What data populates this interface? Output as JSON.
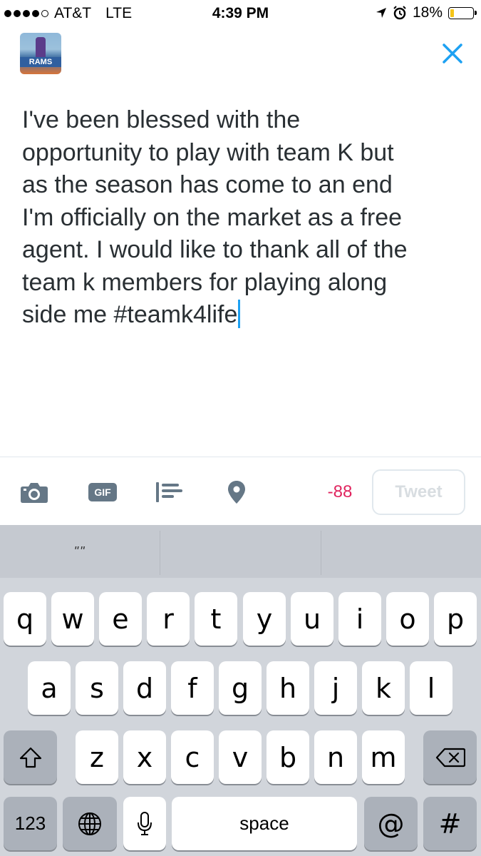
{
  "status_bar": {
    "carrier": "AT&T",
    "network": "LTE",
    "time": "4:39 PM",
    "battery_text": "18%",
    "battery_level": 0.18,
    "battery_color": "#f5c518"
  },
  "header": {
    "avatar_icon": "profile-photo-icon",
    "close_icon": "close-x-icon",
    "accent_color": "#1da1f2"
  },
  "compose": {
    "text": "I've been blessed with the\nopportunity to play with team K but\nas the season has come to an end\nI'm officially on the market as a free\nagent. I would like to thank all of the\nteam k members for playing along\nside me #teamk4life"
  },
  "toolbar": {
    "camera_icon": "camera-icon",
    "gif_label": "GIF",
    "poll_icon": "poll-icon",
    "location_icon": "location-pin-icon",
    "char_count": "-88",
    "tweet_label": "Tweet"
  },
  "keyboard": {
    "prediction": "\"\"",
    "row1": [
      "q",
      "w",
      "e",
      "r",
      "t",
      "y",
      "u",
      "i",
      "o",
      "p"
    ],
    "row2": [
      "a",
      "s",
      "d",
      "f",
      "g",
      "h",
      "j",
      "k",
      "l"
    ],
    "row3": [
      "z",
      "x",
      "c",
      "v",
      "b",
      "n",
      "m"
    ],
    "numbers_label": "123",
    "space_label": "space",
    "at_label": "@",
    "hash_label": "#"
  }
}
